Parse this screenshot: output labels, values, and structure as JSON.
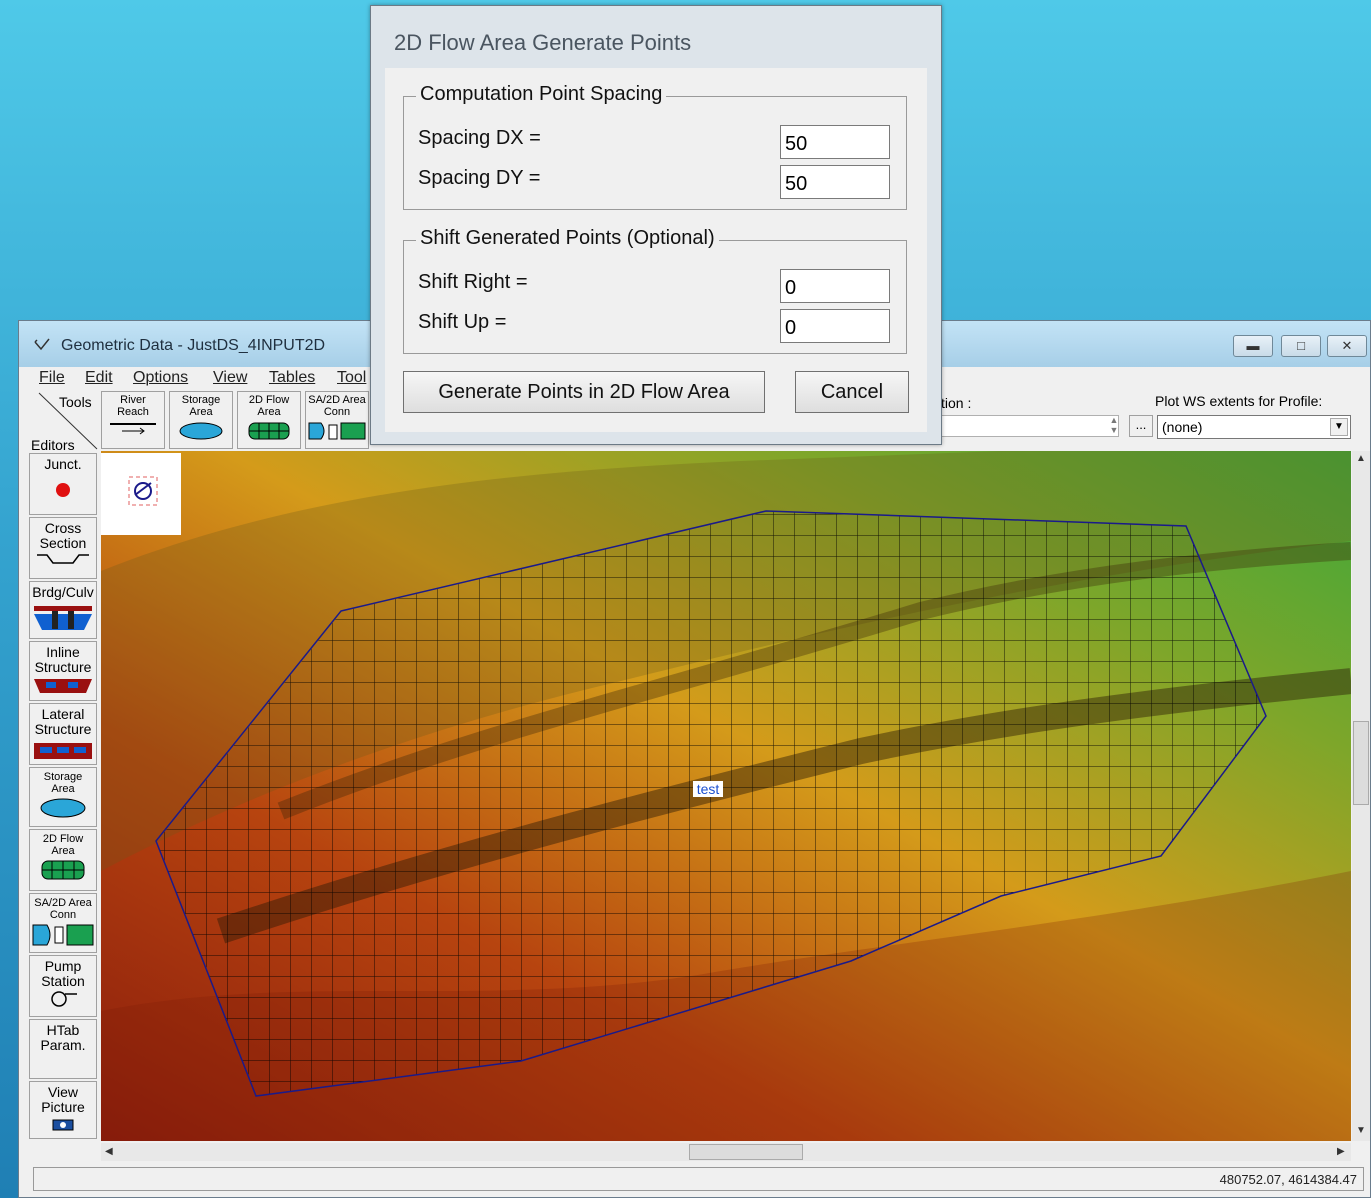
{
  "dialog": {
    "title": "2D Flow Area Generate Points",
    "spacing_group": {
      "title": "Computation Point Spacing",
      "dx_label": "Spacing DX =",
      "dx_value": "50",
      "dy_label": "Spacing DY =",
      "dy_value": "50"
    },
    "shift_group": {
      "title": "Shift Generated Points (Optional)",
      "right_label": "Shift Right =",
      "right_value": "0",
      "up_label": "Shift Up =",
      "up_value": "0"
    },
    "generate_label": "Generate Points in 2D Flow Area",
    "cancel_label": "Cancel"
  },
  "window": {
    "title": "Geometric Data - JustDS_4INPUT2D",
    "menu": [
      "File",
      "Edit",
      "Options",
      "View",
      "Tables",
      "Tool"
    ]
  },
  "toolbar": {
    "tools_label": "Tools",
    "editors_label": "Editors",
    "buttons": [
      {
        "line1": "River",
        "line2": "Reach"
      },
      {
        "line1": "Storage",
        "line2": "Area"
      },
      {
        "line1": "2D Flow",
        "line2": "Area"
      },
      {
        "line1": "SA/2D Area",
        "line2": "Conn"
      }
    ],
    "location_label": "tion :",
    "plot_label": "Plot WS extents for Profile:",
    "profile_value": "(none)",
    "dots_label": "..."
  },
  "side_buttons": [
    {
      "line1": "Junct.",
      "line2": ""
    },
    {
      "line1": "Cross",
      "line2": "Section"
    },
    {
      "line1": "Brdg/Culv",
      "line2": ""
    },
    {
      "line1": "Inline",
      "line2": "Structure"
    },
    {
      "line1": "Lateral",
      "line2": "Structure"
    },
    {
      "line1": "Storage",
      "line2": "Area"
    },
    {
      "line1": "2D Flow",
      "line2": "Area"
    },
    {
      "line1": "SA/2D Area",
      "line2": "Conn"
    },
    {
      "line1": "Pump",
      "line2": "Station"
    },
    {
      "line1": "HTab",
      "line2": "Param."
    },
    {
      "line1": "View",
      "line2": "Picture"
    }
  ],
  "map": {
    "area_label": "test"
  },
  "status": {
    "coordinates": "480752.07, 4614384.47"
  },
  "colors": {
    "background": "#34a3cf",
    "title_bar": "#b3d8ee",
    "terrain_low": "#8a1c0c",
    "terrain_mid": "#d49b1a",
    "terrain_high": "#3ea83a",
    "area_boundary": "#1a1a8a"
  }
}
